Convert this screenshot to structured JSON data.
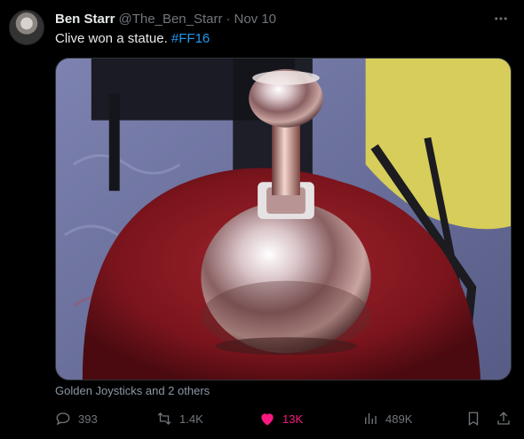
{
  "tweet": {
    "author_name": "Ben Starr",
    "author_handle": "@The_Ben_Starr",
    "separator": "·",
    "date": "Nov 10",
    "text": "Clive won a statue.",
    "hashtag": "#FF16",
    "liked_by": "Golden Joysticks and 2 others"
  },
  "actions": {
    "replies": "393",
    "retweets": "1.4K",
    "likes": "13K",
    "views": "489K"
  },
  "colors": {
    "background": "#000000",
    "text": "#e7e9ea",
    "muted": "#71767b",
    "link": "#1d9bf0",
    "like": "#f91880"
  },
  "icons": {
    "avatar": "avatar",
    "more": "more-icon",
    "reply": "reply-icon",
    "retweet": "retweet-icon",
    "like": "heart-icon",
    "views": "views-icon",
    "bookmark": "bookmark-icon",
    "share": "share-icon"
  }
}
